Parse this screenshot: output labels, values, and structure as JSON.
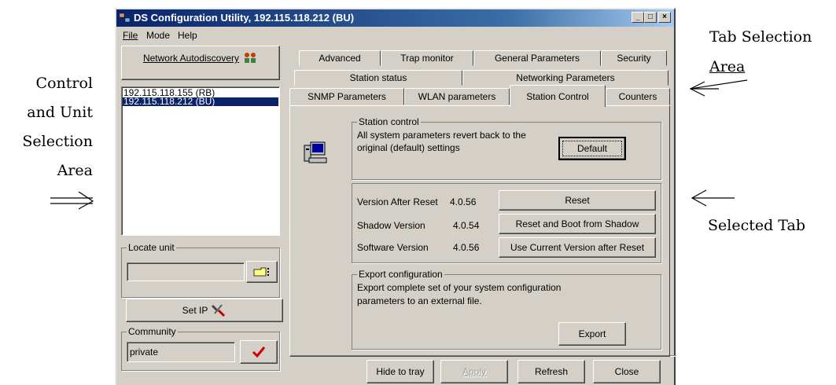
{
  "annotations": {
    "tab_selection_line1": "Tab Selection",
    "tab_selection_line2": "Area",
    "control_line1": "Control",
    "control_line2": "and Unit",
    "control_line3": "Selection",
    "control_line4": "Area",
    "selected_tab": "Selected Tab"
  },
  "window": {
    "title": "DS Configuration Utility, 192.115.118.212  (BU)",
    "minimize": "_",
    "maximize": "□",
    "close": "×"
  },
  "menu": {
    "file": "File",
    "mode": "Mode",
    "help": "Help"
  },
  "left": {
    "autodiscovery_label": "Network Autodiscovery",
    "units": [
      "192.115.118.155  (RB)",
      "192.115.118.212  (BU)"
    ],
    "selected_unit_index": 1,
    "locate_unit_label": "Locate unit",
    "locate_unit_value": "",
    "set_ip_label": "Set IP",
    "community_label": "Community",
    "community_value": "private"
  },
  "tabs": {
    "row1": [
      "Advanced",
      "Trap monitor",
      "General Parameters",
      "Security"
    ],
    "row2": [
      "Station status",
      "Networking Parameters"
    ],
    "row3": [
      "SNMP Parameters",
      "WLAN parameters",
      "Station Control",
      "Counters"
    ],
    "active": "Station Control"
  },
  "station_control": {
    "group_title": "Station control",
    "description_line1": "All system parameters revert back to the",
    "description_line2": "original (default) settings",
    "default_button": "Default"
  },
  "versions": {
    "after_reset_label": "Version After Reset",
    "after_reset_value": "4.0.56",
    "shadow_label": "Shadow Version",
    "shadow_value": "4.0.54",
    "software_label": "Software Version",
    "software_value": "4.0.56",
    "reset_button": "Reset",
    "reset_boot_shadow_button": "Reset and Boot from Shadow",
    "use_current_button": "Use Current Version after Reset"
  },
  "export": {
    "group_title": "Export configuration",
    "description_line1": "Export complete set of your system configuration",
    "description_line2": "parameters to an external file.",
    "export_button": "Export"
  },
  "footer": {
    "hide_to_tray": "Hide to tray",
    "apply": "Apply",
    "refresh": "Refresh",
    "close": "Close"
  },
  "colors": {
    "face": "#d4d0c8",
    "title_start": "#0a246a",
    "selection": "#0a246a",
    "check_red": "#d00000"
  },
  "icons": {
    "app": "network-app-icon",
    "autodiscovery": "network-people-icon",
    "locate": "pointing-hand-icon",
    "set_ip": "tools-icon",
    "community_ok": "checkmark-icon",
    "station_control": "computer-icon"
  }
}
